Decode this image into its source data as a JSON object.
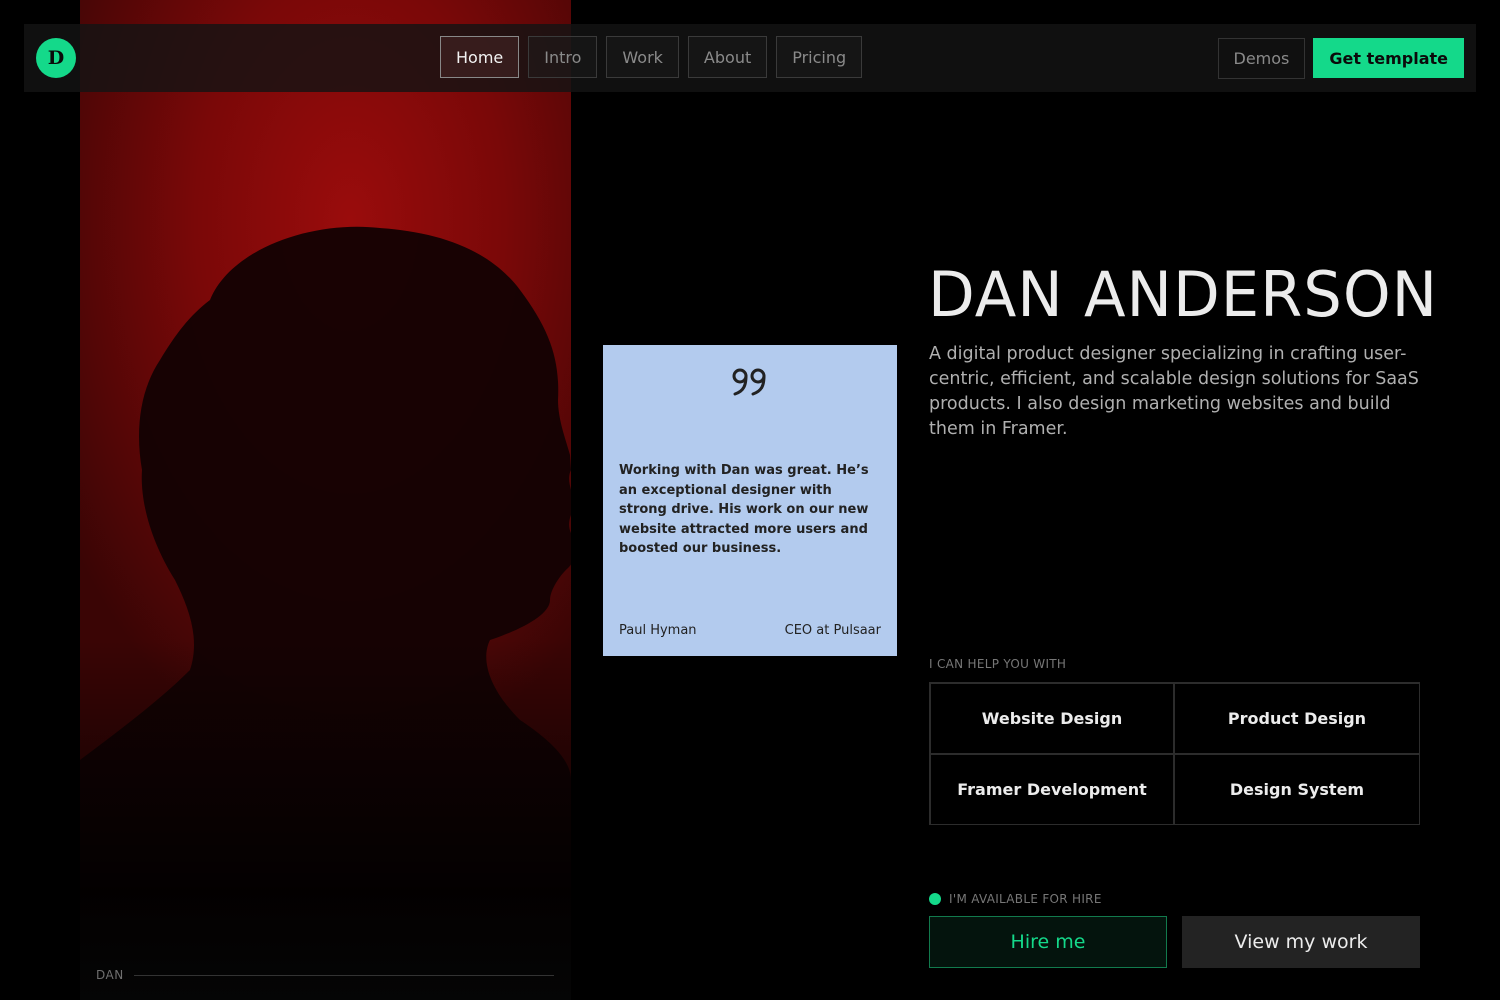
{
  "nav": {
    "logo_letter": "D",
    "links": [
      {
        "label": "Home",
        "active": true
      },
      {
        "label": "Intro",
        "active": false
      },
      {
        "label": "Work",
        "active": false
      },
      {
        "label": "About",
        "active": false
      },
      {
        "label": "Pricing",
        "active": false
      }
    ],
    "demos_label": "Demos",
    "get_template_label": "Get template"
  },
  "portrait": {
    "caption": "DAN"
  },
  "testimonial": {
    "quote_icon": "quote-icon",
    "text": "Working with Dan was great. He’s an exceptional designer with strong drive. His work on our new website attracted more users and boosted our business.",
    "author": "Paul Hyman",
    "role": "CEO at Pulsaar"
  },
  "hero": {
    "name": "DAN ANDERSON",
    "bio": "A digital product designer specializing in crafting user-centric, efficient, and scalable design solutions for SaaS products. I also design marketing websites and build them in Framer."
  },
  "services": {
    "label": "I CAN HELP YOU WITH",
    "items": [
      "Website Design",
      "Product Design",
      "Framer Development",
      "Design System"
    ]
  },
  "availability": {
    "label": "I'M AVAILABLE FOR HIRE",
    "hire_label": "Hire me",
    "view_work_label": "View my work"
  },
  "colors": {
    "accent": "#14d98a",
    "testimonial_bg": "#b3cbee",
    "portrait_bg": "#8a0a0a",
    "page_bg": "#000000"
  }
}
